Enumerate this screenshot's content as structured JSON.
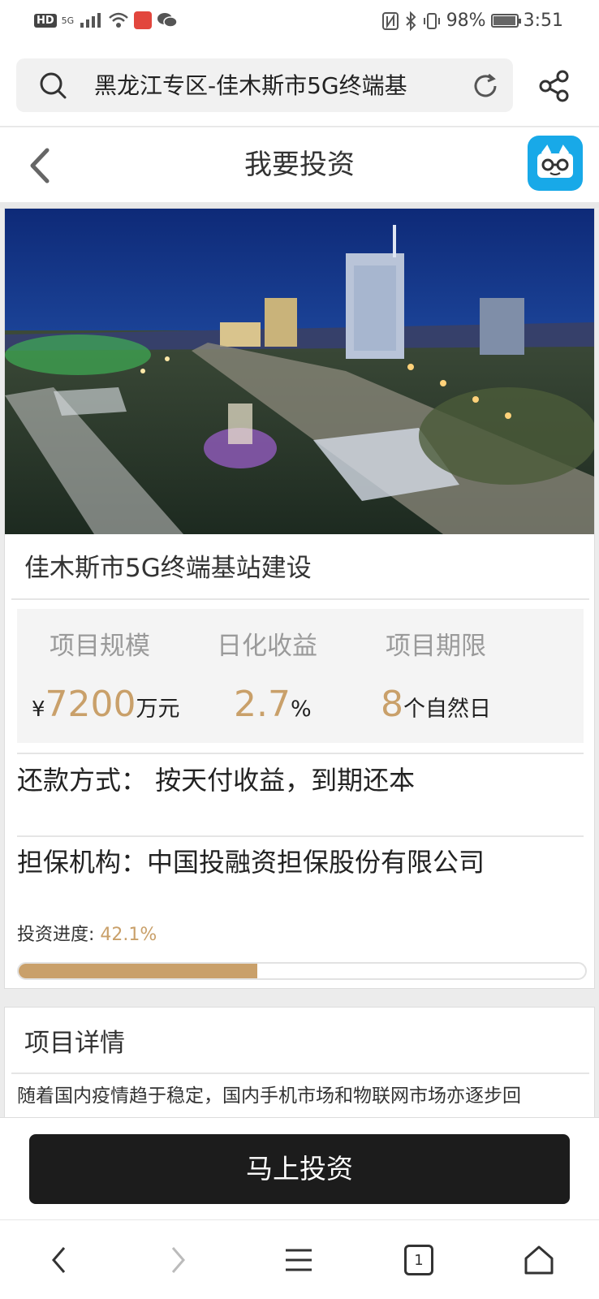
{
  "status_bar": {
    "network_left": "HD",
    "network_gen": "5G",
    "battery": "98%",
    "time": "3:51"
  },
  "url_bar": {
    "url_text": "黑龙江专区-佳木斯市5G终端基"
  },
  "header": {
    "title": "我要投资"
  },
  "project": {
    "title": "佳木斯市5G终端基站建设",
    "stats": [
      {
        "label": "项目规模",
        "prefix": "¥",
        "value": "7200",
        "unit": "万元"
      },
      {
        "label": "日化收益",
        "prefix": "",
        "value": "2.7",
        "unit": "%"
      },
      {
        "label": "项目期限",
        "prefix": "",
        "value": "8",
        "unit": "个自然日"
      }
    ],
    "repayment": "还款方式： 按天付收益，到期还本",
    "guarantor": "担保机构：中国投融资担保股份有限公司",
    "progress_label": "投资进度:",
    "progress_value": "42.1%",
    "progress_fraction": 0.421
  },
  "details": {
    "title": "项目详情",
    "text": "随着国内疫情趋于稳定，国内手机市场和物联网市场亦逐步回"
  },
  "action": {
    "invest_label": "马上投资"
  },
  "browser_nav": {
    "tab_count": "1"
  },
  "colors": {
    "accent_gold": "#c9a06a",
    "button_dark": "#1c1c1c",
    "app_badge_blue": "#18a9e8"
  }
}
